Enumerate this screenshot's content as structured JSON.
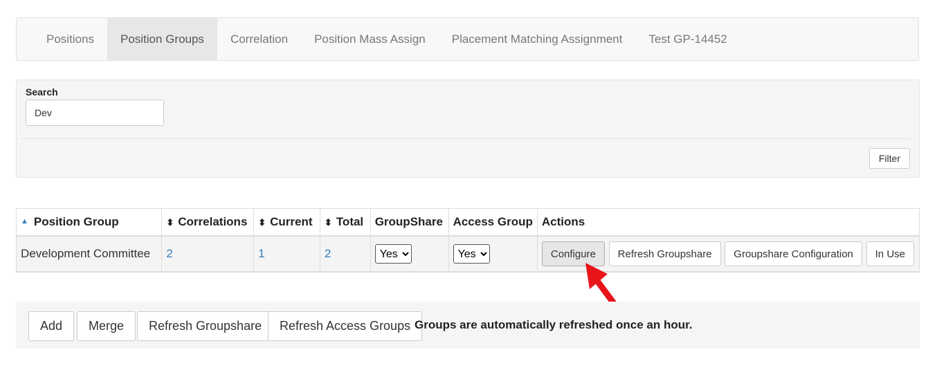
{
  "tabs": [
    {
      "label": "Positions"
    },
    {
      "label": "Position Groups"
    },
    {
      "label": "Correlation"
    },
    {
      "label": "Position Mass Assign"
    },
    {
      "label": "Placement Matching Assignment"
    },
    {
      "label": "Test GP-14452"
    }
  ],
  "search": {
    "label": "Search",
    "value": "Dev",
    "filter_label": "Filter"
  },
  "table": {
    "headers": {
      "position_group": "Position Group",
      "correlations": "Correlations",
      "current": "Current",
      "total": "Total",
      "groupshare": "GroupShare",
      "access_group": "Access Group",
      "actions": "Actions"
    },
    "rows": [
      {
        "position_group": "Development Committee",
        "correlations": "2",
        "current": "1",
        "total": "2",
        "groupshare": "Yes",
        "access_group": "Yes",
        "actions": {
          "configure": "Configure",
          "refresh_groupshare": "Refresh Groupshare",
          "groupshare_configuration": "Groupshare Configuration",
          "in_use": "In Use"
        }
      }
    ]
  },
  "footer": {
    "add": "Add",
    "merge": "Merge",
    "refresh_groupshare": "Refresh Groupshare",
    "refresh_access_groups": "Refresh Access Groups",
    "note": "Groups are automatically refreshed once an hour."
  },
  "colors": {
    "link": "#337ab7",
    "annotation_arrow": "#e8141a"
  },
  "icons": {
    "sort": "sort-icon",
    "sort_asc": "sort-asc-icon",
    "annotation": "red-arrow-icon"
  }
}
